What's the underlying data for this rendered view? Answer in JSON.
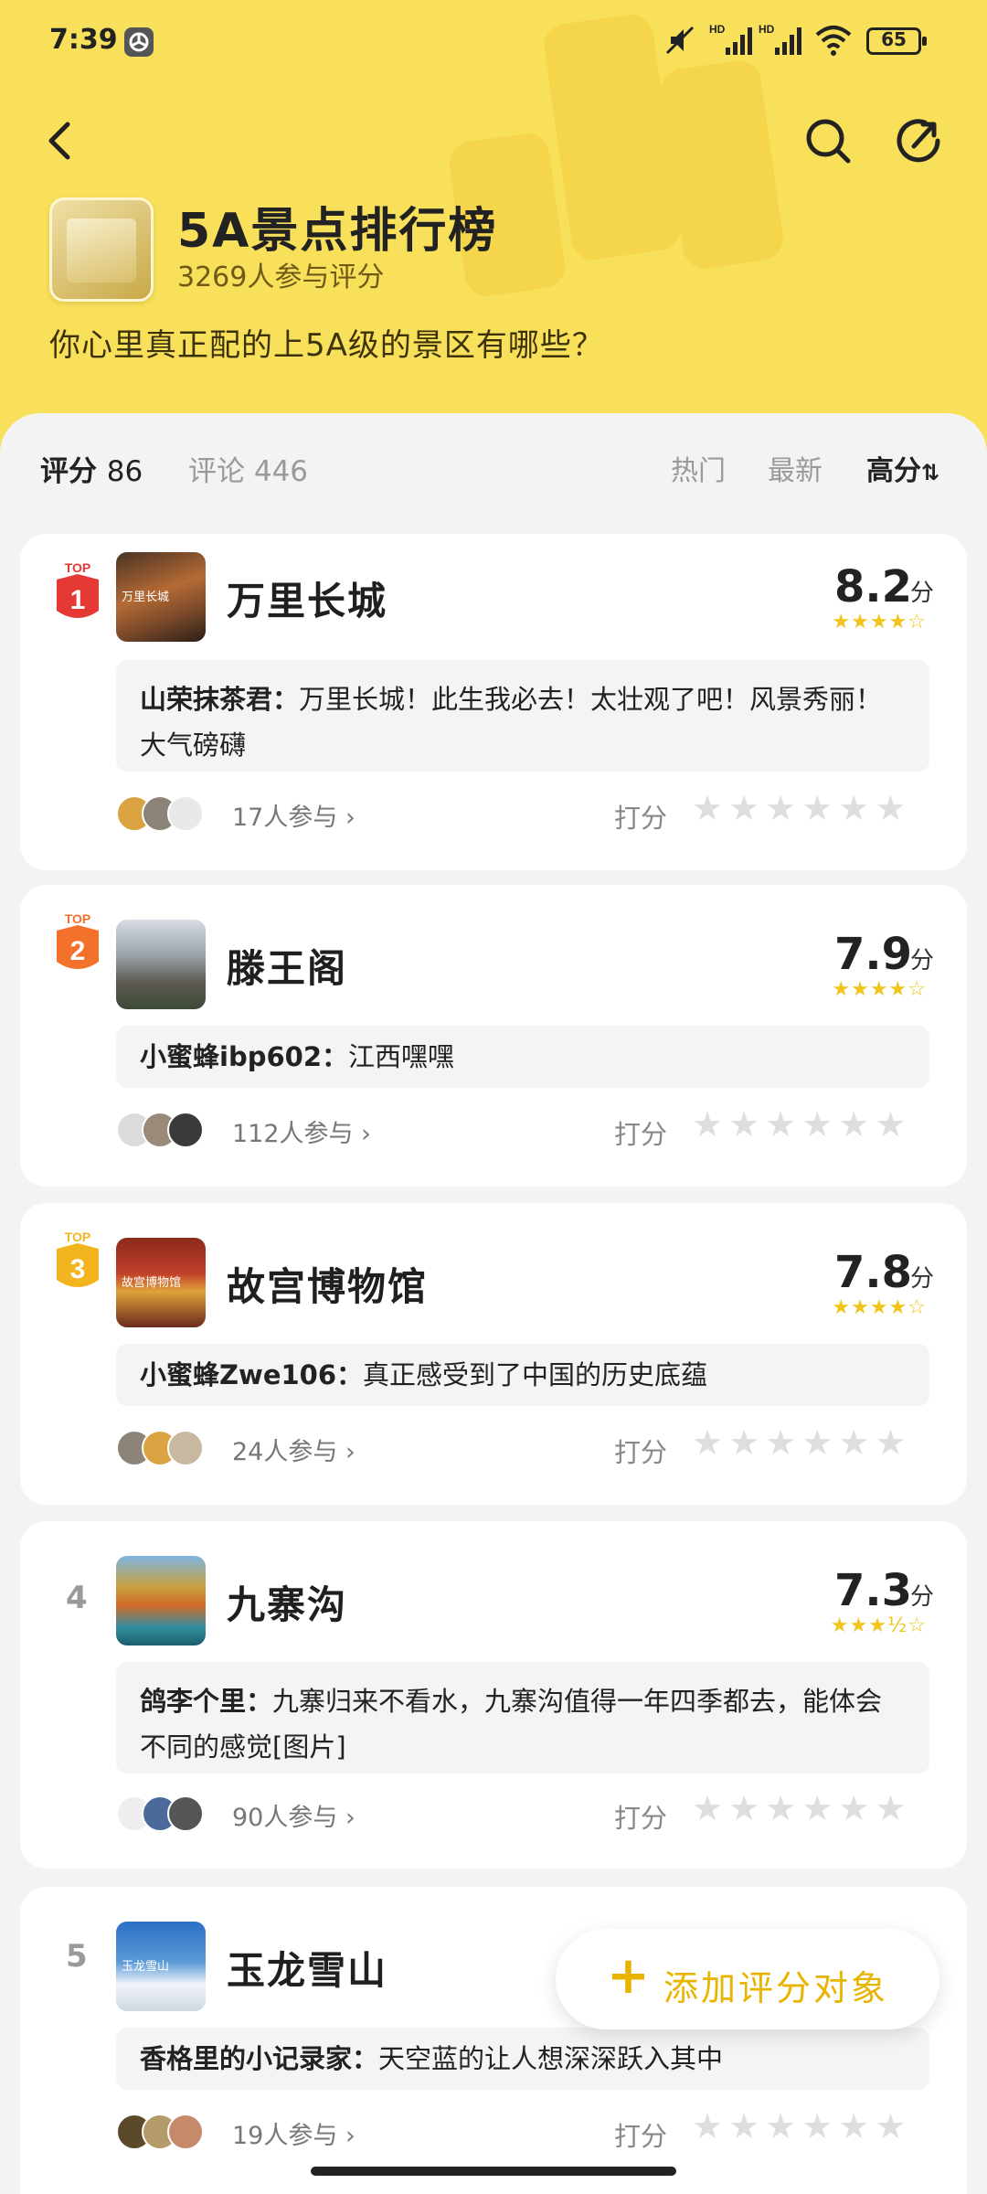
{
  "status_bar": {
    "time": "7:39",
    "battery": "65"
  },
  "header": {
    "title": "5A景点排行榜",
    "participants": "3269人参与评分",
    "question": "你心里真正配的上5A级的景区有哪些？"
  },
  "tabs": {
    "score_label": "评分",
    "score_count": "86",
    "comment_label": "评论",
    "comment_count": "446"
  },
  "sort": {
    "hot": "热门",
    "latest": "最新",
    "high": "高分",
    "selected": "高分"
  },
  "items": [
    {
      "rank": "1",
      "badge": "TOP",
      "name": "万里长城",
      "score": "8.2",
      "unit": "分",
      "stars": 4,
      "stars_text": "★★★★☆",
      "thumb_text": "万里长城",
      "comment_user": "山荣抹茶君：",
      "comment_text": "万里长城！此生我必去！太壮观了吧！风景秀丽！大气磅礴",
      "participants": "17人参与",
      "rate_label": "打分",
      "rate_stars": "★★★★★★"
    },
    {
      "rank": "2",
      "badge": "TOP",
      "name": "滕王阁",
      "score": "7.9",
      "unit": "分",
      "stars": 4,
      "stars_text": "★★★★☆",
      "thumb_text": "",
      "comment_user": "小蜜蜂ibp602：",
      "comment_text": "江西嘿嘿",
      "participants": "112人参与",
      "rate_label": "打分",
      "rate_stars": "★★★★★★"
    },
    {
      "rank": "3",
      "badge": "TOP",
      "name": "故宫博物馆",
      "score": "7.8",
      "unit": "分",
      "stars": 4,
      "stars_text": "★★★★☆",
      "thumb_text": "故宫博物馆",
      "comment_user": "小蜜蜂Zwe106：",
      "comment_text": "真正感受到了中国的历史底蕴",
      "participants": "24人参与",
      "rate_label": "打分",
      "rate_stars": "★★★★★★"
    },
    {
      "rank": "4",
      "badge": "",
      "name": "九寨沟",
      "score": "7.3",
      "unit": "分",
      "stars": 3.5,
      "stars_text": "★★★½☆",
      "thumb_text": "",
      "comment_user": "鸽李个里：",
      "comment_text": "九寨归来不看水，九寨沟值得一年四季都去，能体会不同的感觉[图片]",
      "participants": "90人参与",
      "rate_label": "打分",
      "rate_stars": "★★★★★★"
    },
    {
      "rank": "5",
      "badge": "",
      "name": "玉龙雪山",
      "score": "",
      "unit": "",
      "stars": 0,
      "stars_text": "",
      "thumb_text": "玉龙雪山",
      "comment_user": "香格里的小记录家：",
      "comment_text": "天空蓝的让人想深深跃入其中",
      "participants": "19人参与",
      "rate_label": "打分",
      "rate_stars": "★★★★★★"
    }
  ],
  "fab": {
    "icon": "+",
    "label": "添加评分对象"
  },
  "colors": {
    "header_bg": "#f9e05a",
    "accent": "#e8b400",
    "star": "#f0c419",
    "rank1": "#e53935",
    "rank2": "#f4712b",
    "rank3": "#f2b51f"
  }
}
